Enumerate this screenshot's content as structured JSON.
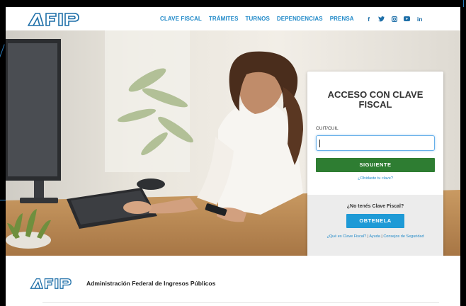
{
  "header": {
    "logo_alt": "AFIP",
    "nav": [
      "CLAVE FISCAL",
      "TRÁMITES",
      "TURNOS",
      "DEPENDENCIAS",
      "PRENSA"
    ],
    "social": [
      "f",
      "twitter-icon",
      "instagram-icon",
      "youtube-icon",
      "in"
    ],
    "facebook_label": "f",
    "linkedin_label": "in"
  },
  "login": {
    "title": "ACCESO CON CLAVE FISCAL",
    "cuit_label": "CUIT/CUIL",
    "cuit_value": "",
    "next_button": "SIGUIENTE",
    "forgot_link": "¿Olvidaste tu clave?",
    "no_clave_text": "¿No tenés Clave Fiscal?",
    "get_button": "OBTENELA",
    "help_link_1": "¿Qué es Clave Fiscal?",
    "help_link_2": "Ayuda",
    "help_link_3": "Consejos de Seguridad",
    "separator": "|"
  },
  "footer": {
    "org_name": "Administración Federal de Ingresos Públicos"
  },
  "colors": {
    "accent_blue": "#1e88c8",
    "next_button_green": "#2e7d32",
    "get_button_blue": "#1e9ad6"
  }
}
